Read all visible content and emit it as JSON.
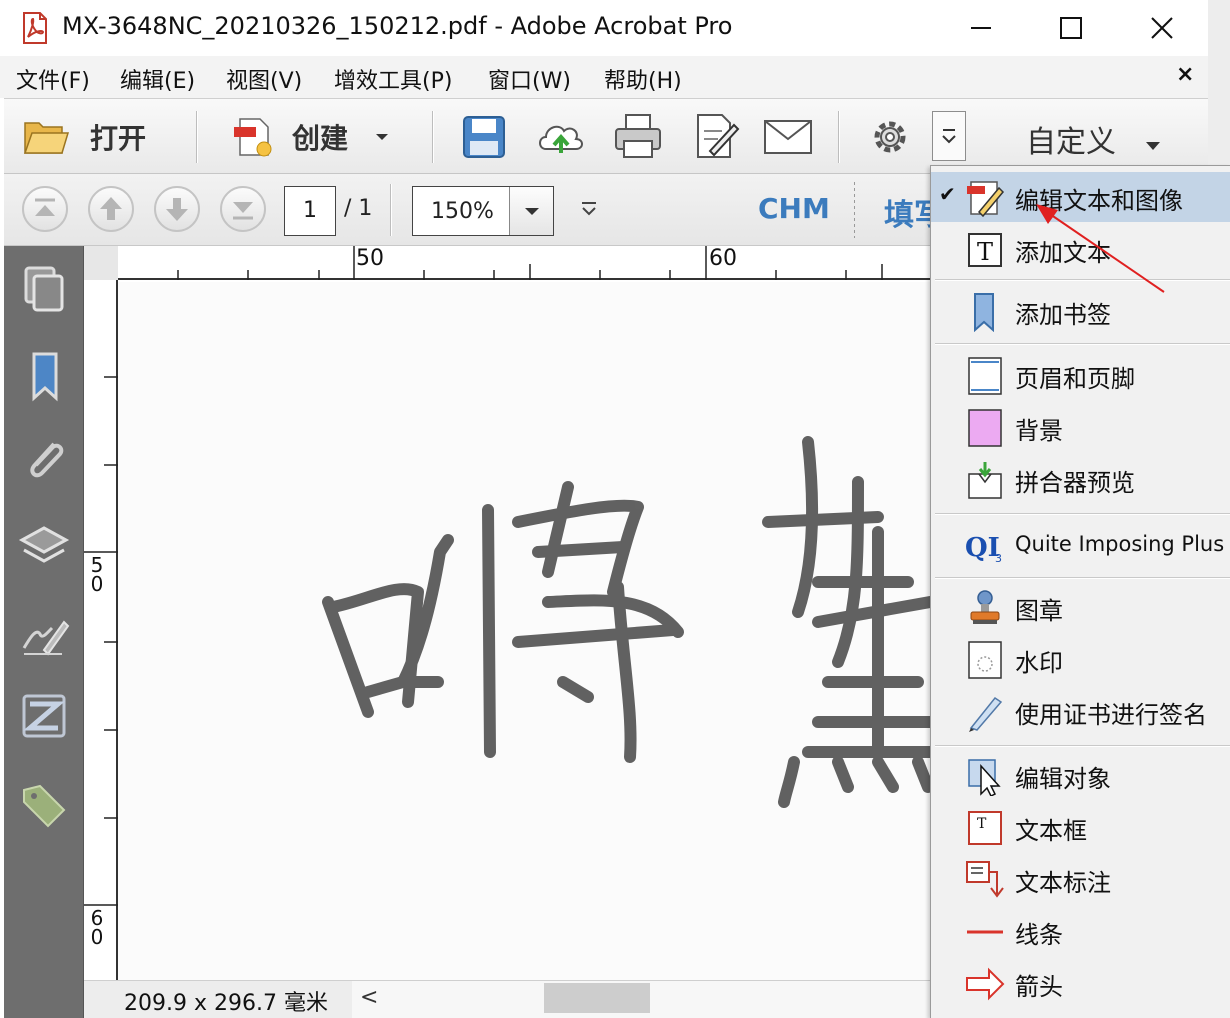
{
  "window": {
    "title": "MX-3648NC_20210326_150212.pdf - Adobe Acrobat Pro"
  },
  "menubar": {
    "items": [
      "文件(F)",
      "编辑(E)",
      "视图(V)",
      "增效工具(P)",
      "窗口(W)",
      "帮助(H)"
    ],
    "close_glyph": "×"
  },
  "toolbar": {
    "open_label": "打开",
    "create_label": "创建",
    "customize_label": "自定义"
  },
  "nav": {
    "page_current": "1",
    "page_total": "/ 1",
    "zoom": "150%",
    "chm_label": "CHM",
    "fill_label": "填写"
  },
  "ruler": {
    "top_labels": [
      "50",
      "60"
    ],
    "left_labels": [
      "5\n0",
      "6\n0"
    ]
  },
  "document": {
    "handwriting": "嗗 鷙"
  },
  "status": {
    "page_size": "209.9 x 296.7 毫米",
    "scroll_left_glyph": "<"
  },
  "dropdown": {
    "items": [
      {
        "label": "编辑文本和图像",
        "icon": "edit-text-image-icon",
        "checked": true
      },
      {
        "label": "添加文本",
        "icon": "add-text-icon"
      },
      {
        "label": "添加书签",
        "icon": "bookmark-icon"
      },
      {
        "label": "页眉和页脚",
        "icon": "header-footer-icon"
      },
      {
        "label": "背景",
        "icon": "background-icon"
      },
      {
        "label": "拼合器预览",
        "icon": "flattener-preview-icon"
      },
      {
        "label": "Quite Imposing Plus 3",
        "icon": "quite-imposing-icon"
      },
      {
        "label": "图章",
        "icon": "stamp-icon"
      },
      {
        "label": "水印",
        "icon": "watermark-icon"
      },
      {
        "label": "使用证书进行签名",
        "icon": "certificate-sign-icon"
      },
      {
        "label": "编辑对象",
        "icon": "edit-object-icon"
      },
      {
        "label": "文本框",
        "icon": "text-box-icon"
      },
      {
        "label": "文本标注",
        "icon": "text-callout-icon"
      },
      {
        "label": "线条",
        "icon": "line-icon"
      },
      {
        "label": "箭头",
        "icon": "arrow-icon"
      }
    ],
    "check_glyph": "✔"
  },
  "colors": {
    "accent_blue": "#3b7bbd",
    "selected_bg": "#c3d4e6",
    "annotation_red": "#e02020",
    "left_panel": "#6e6e6e"
  }
}
